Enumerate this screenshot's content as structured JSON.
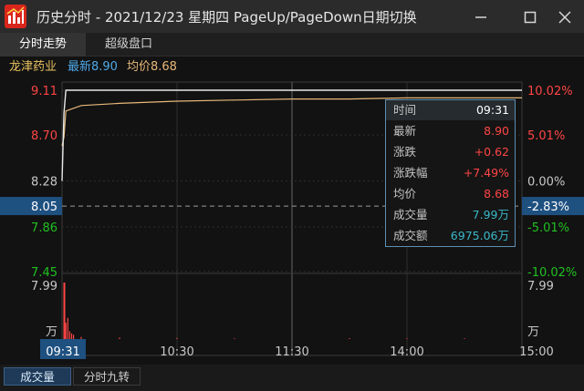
{
  "window": {
    "title": "历史分时 - 2021/12/23 星期四 PageUp/PageDown日期切换"
  },
  "tabs": [
    {
      "label": "分时走势",
      "active": true
    },
    {
      "label": "超级盘口",
      "active": false
    }
  ],
  "stock": {
    "name": "龙津药业",
    "latest_label": "最新8.90",
    "avg_label": "均价8.68"
  },
  "axes": {
    "price_ticks": [
      "9.11",
      "8.70",
      "8.28",
      "8.05",
      "7.86",
      "7.45"
    ],
    "pct_ticks": [
      "10.02%",
      "5.01%",
      "0.00%",
      "-2.83%",
      "-5.01%",
      "-10.02%"
    ],
    "vol_ticks_left": [
      "7.99",
      "万"
    ],
    "vol_ticks_right": [
      "7.99",
      "万"
    ],
    "time_ticks": [
      "09:31",
      "10:30",
      "11:30",
      "14:00",
      "15:00"
    ]
  },
  "tooltip": {
    "rows": [
      {
        "key": "时间",
        "value": "09:31"
      },
      {
        "key": "最新",
        "value": "8.90"
      },
      {
        "key": "涨跌",
        "value": "+0.62"
      },
      {
        "key": "涨跌幅",
        "value": "+7.49%"
      },
      {
        "key": "均价",
        "value": "8.68"
      },
      {
        "key": "成交量",
        "value": "7.99万"
      },
      {
        "key": "成交额",
        "value": "6975.06万"
      }
    ]
  },
  "bottom_tabs": [
    {
      "label": "成交量",
      "active": true
    },
    {
      "label": "分时九转",
      "active": false
    }
  ],
  "colors": {
    "up": "#ff4545",
    "down": "#20c020",
    "neutral": "#c8c8c8",
    "price_line": "#e8e8e8",
    "avg_line": "#e8b87a",
    "accent_blue": "#1e5080",
    "cyan": "#3ab8c8"
  },
  "chart_data": {
    "type": "line",
    "series": [
      {
        "x": [
          "09:30",
          "09:31",
          "09:32",
          "10:00",
          "10:30",
          "11:00",
          "11:30",
          "13:30",
          "14:00",
          "14:30",
          "15:00"
        ],
        "values": [
          8.28,
          8.9,
          9.11,
          9.11,
          9.11,
          9.11,
          9.11,
          9.11,
          9.11,
          9.11,
          9.11
        ]
      },
      {
        "x": [
          "09:30",
          "09:31",
          "09:32",
          "09:40",
          "10:00",
          "10:30",
          "11:00",
          "11:30",
          "13:30",
          "14:00",
          "14:30",
          "15:00"
        ],
        "values": [
          8.6,
          8.68,
          8.92,
          8.97,
          8.99,
          9.01,
          9.02,
          9.03,
          9.03,
          9.04,
          9.04,
          9.04
        ]
      }
    ],
    "ylim": [
      7.45,
      9.11
    ],
    "crosshair_price": 8.05,
    "volume": {
      "max": 7.99,
      "x": [
        "09:31",
        "09:32",
        "09:33",
        "09:34",
        "09:35",
        "09:36",
        "09:40",
        "10:00",
        "10:30",
        "11:00",
        "13:30",
        "14:00",
        "14:30"
      ],
      "values": [
        7.99,
        2.3,
        3.0,
        1.1,
        0.8,
        0.6,
        0.3,
        0.2,
        0.15,
        0.1,
        0.12,
        0.1,
        0.1
      ]
    }
  }
}
